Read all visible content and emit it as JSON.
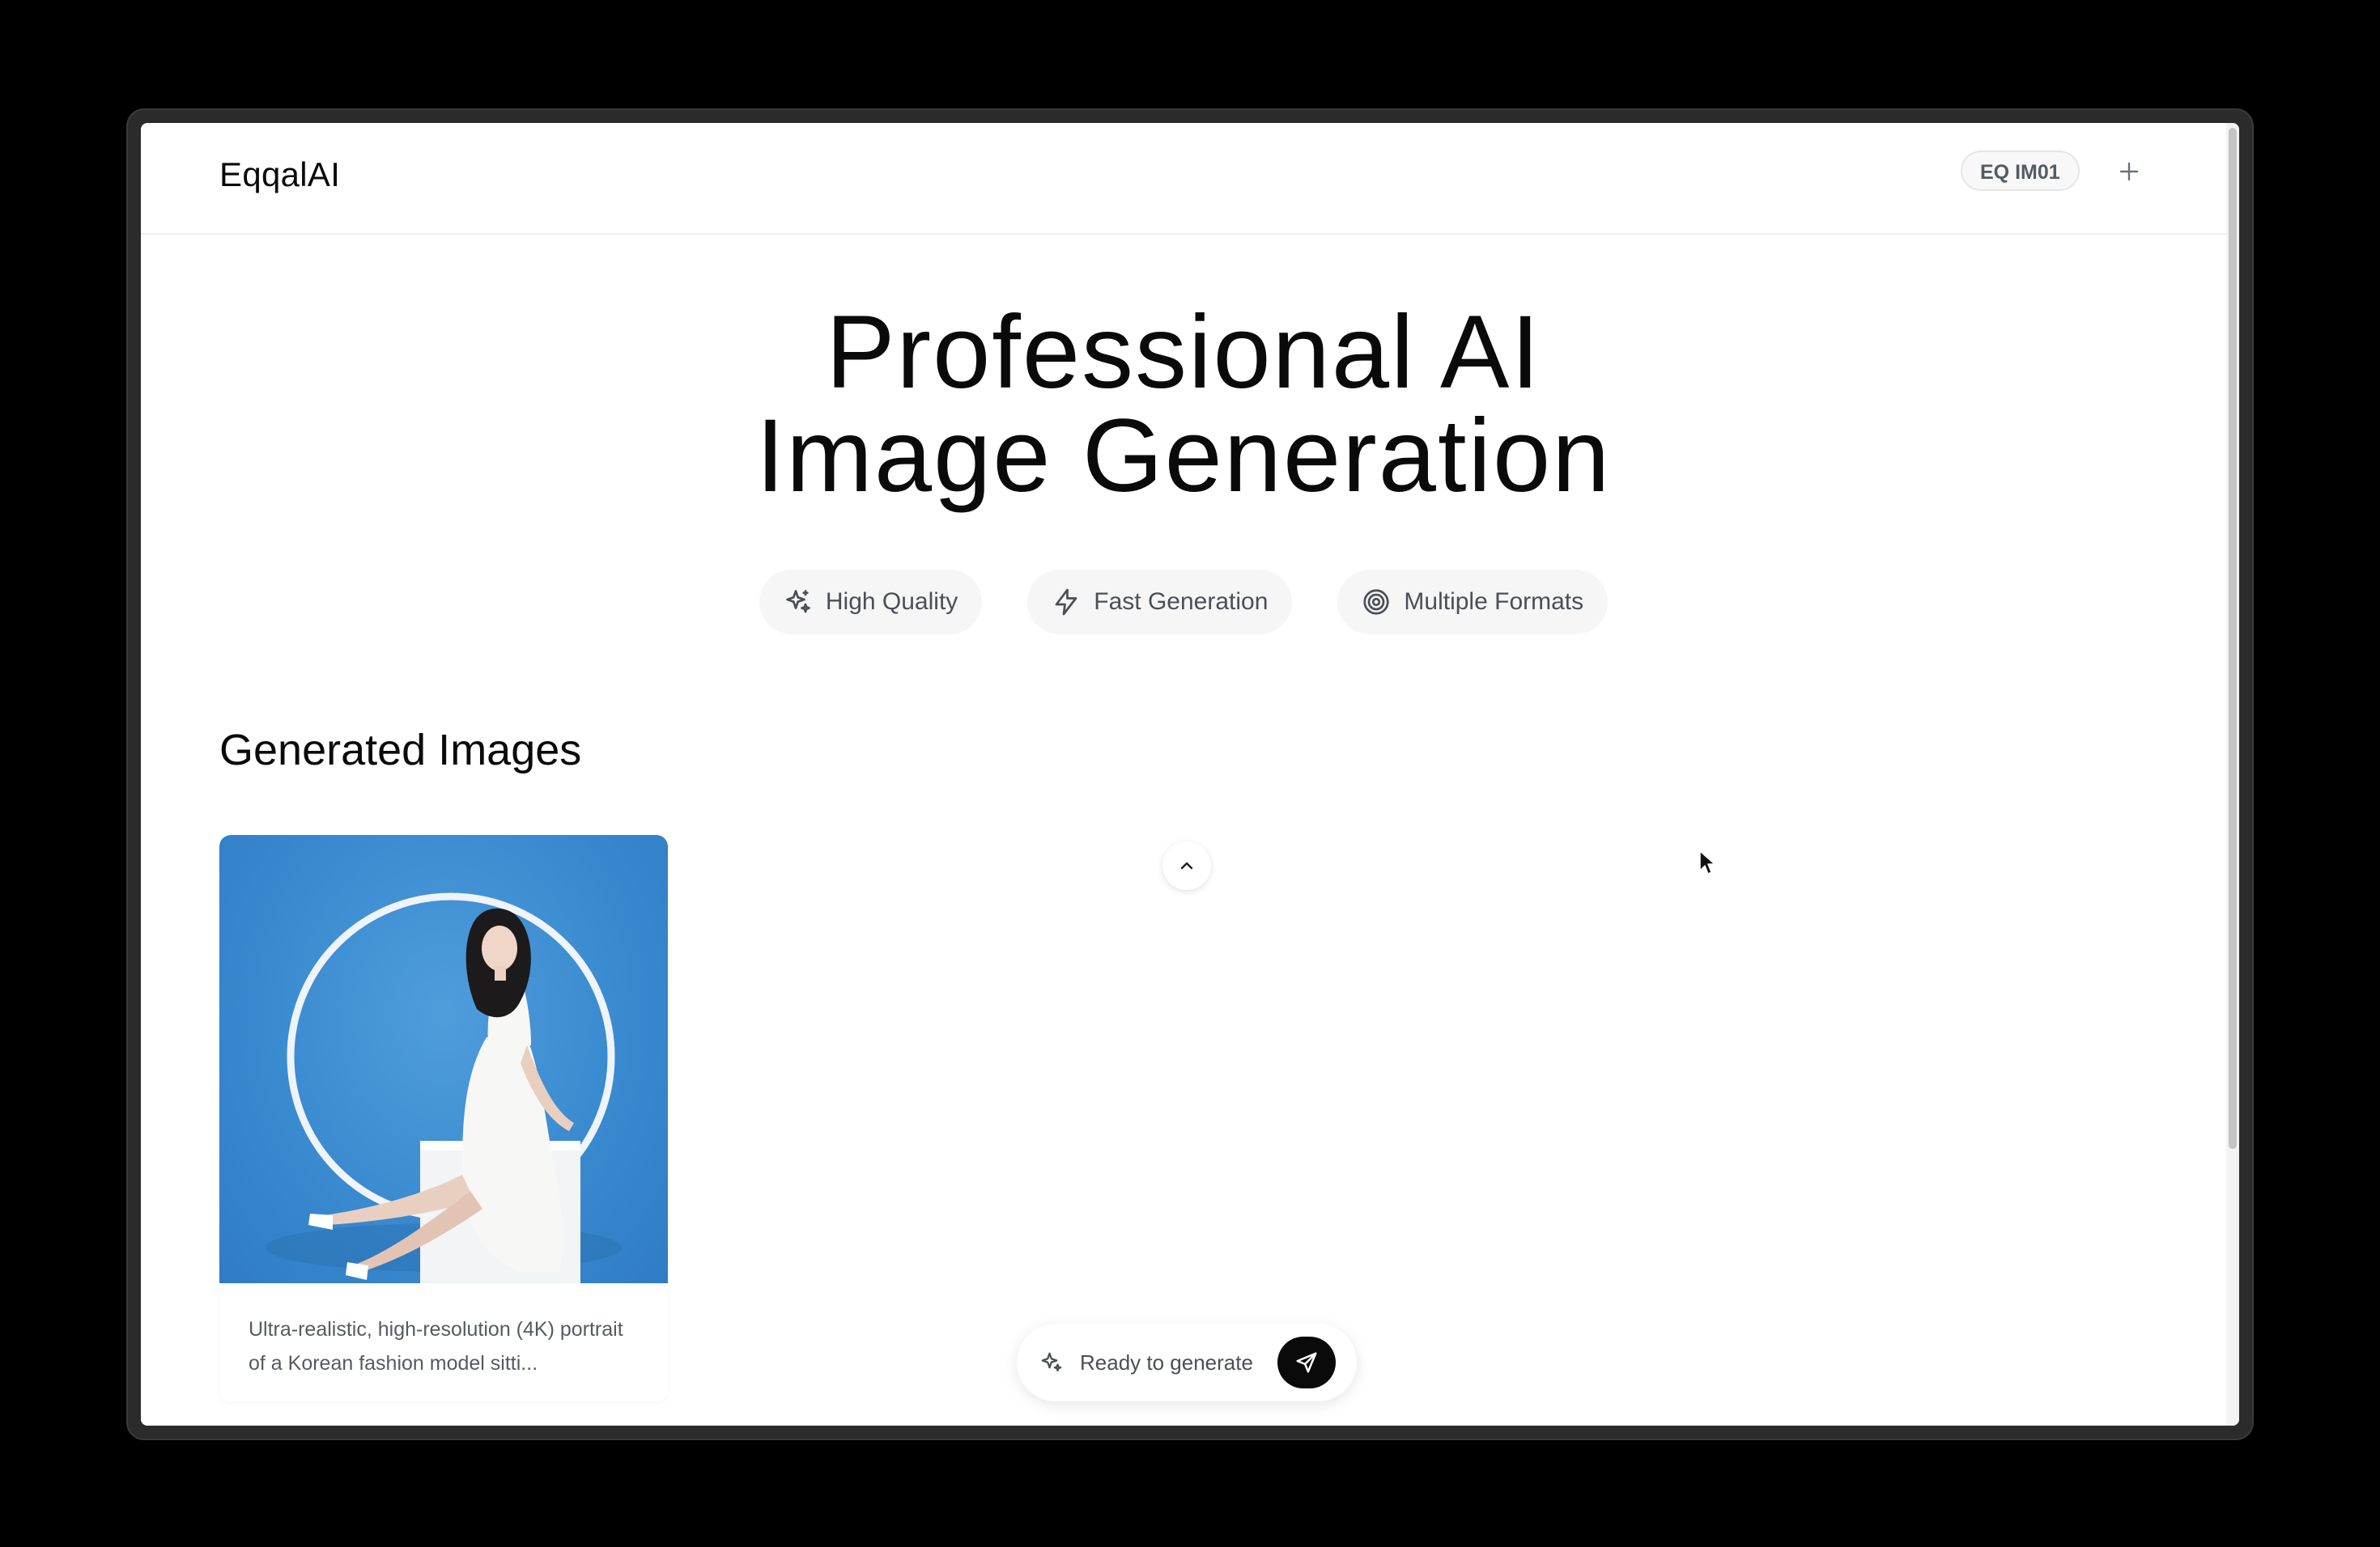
{
  "app": {
    "logo": "EqqalAI",
    "model_badge": "EQ IM01",
    "new_button_icon": "plus-icon"
  },
  "hero": {
    "title_line1": "Professional AI",
    "title_line2": "Image Generation",
    "features": [
      {
        "label": "High Quality",
        "icon": "sparkles-icon"
      },
      {
        "label": "Fast Generation",
        "icon": "lightning-icon"
      },
      {
        "label": "Multiple Formats",
        "icon": "target-icon"
      }
    ]
  },
  "gallery": {
    "title": "Generated Images",
    "items": [
      {
        "caption": "Ultra-realistic, high-resolution (4K) portrait of a Korean fashion model sitti...",
        "image_background": "#3a8ad0"
      }
    ]
  },
  "generator": {
    "status": "Ready to generate",
    "send_icon": "send-icon"
  },
  "colors": {
    "text_primary": "#0a0a0a",
    "text_secondary": "#4a4f57",
    "pill_background": "#f6f6f6",
    "send_button": "#0a0a0a"
  }
}
